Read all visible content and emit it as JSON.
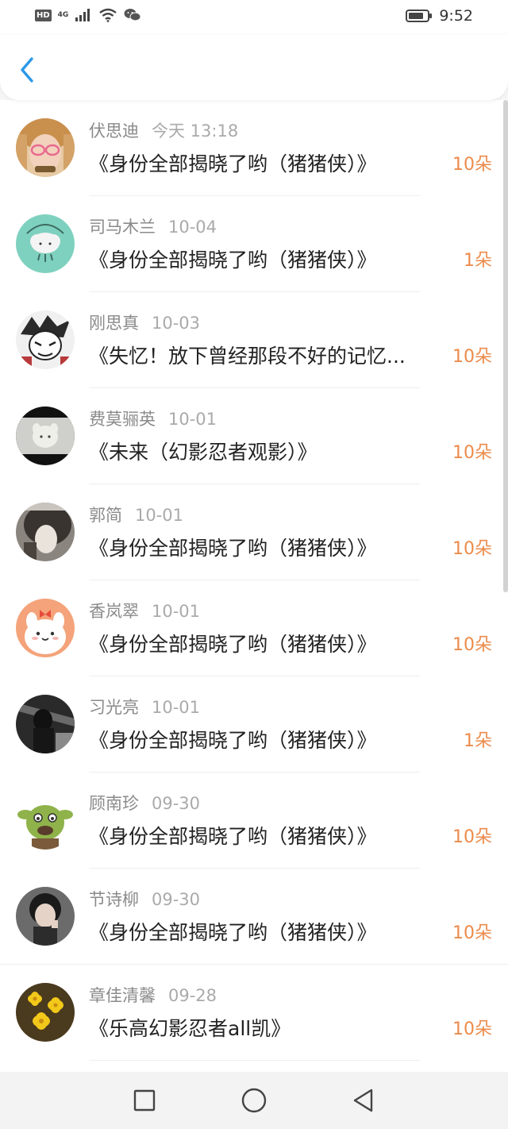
{
  "status_bar": {
    "hd": "HD",
    "network": "4G",
    "time": "9:52",
    "icons": [
      "signal-icon",
      "wifi-icon",
      "wechat-icon",
      "battery-icon"
    ]
  },
  "header": {
    "back_icon": "back-chevron-icon",
    "accent": "#2b98e8"
  },
  "colors": {
    "count": "#ec8b4c",
    "name": "#8a8a8a",
    "date": "#aaaaaa"
  },
  "items": [
    {
      "name": "伏思迪",
      "date": "今天 13:18",
      "title": "《身份全部揭晓了哟（猪猪侠）》",
      "count": "10朵"
    },
    {
      "name": "司马木兰",
      "date": "10-04",
      "title": "《身份全部揭晓了哟（猪猪侠）》",
      "count": "1朵"
    },
    {
      "name": "刚思真",
      "date": "10-03",
      "title": "《失忆！放下曾经那段不好的记忆...",
      "count": "10朵"
    },
    {
      "name": "费莫骊英",
      "date": "10-01",
      "title": "《未来（幻影忍者观影）》",
      "count": "10朵"
    },
    {
      "name": "郭简",
      "date": "10-01",
      "title": "《身份全部揭晓了哟（猪猪侠）》",
      "count": "10朵"
    },
    {
      "name": "香岚翠",
      "date": "10-01",
      "title": "《身份全部揭晓了哟（猪猪侠）》",
      "count": "10朵"
    },
    {
      "name": "习光亮",
      "date": "10-01",
      "title": "《身份全部揭晓了哟（猪猪侠）》",
      "count": "1朵"
    },
    {
      "name": "顾南珍",
      "date": "09-30",
      "title": "《身份全部揭晓了哟（猪猪侠）》",
      "count": "10朵"
    },
    {
      "name": "节诗柳",
      "date": "09-30",
      "title": "《身份全部揭晓了哟（猪猪侠）》",
      "count": "10朵"
    },
    {
      "name": "章佳清馨",
      "date": "09-28",
      "title": "《乐高幻影忍者all凯》",
      "count": "10朵"
    }
  ],
  "nav_bar": {
    "icons": [
      "recent-apps-icon",
      "home-icon",
      "back-icon"
    ]
  }
}
